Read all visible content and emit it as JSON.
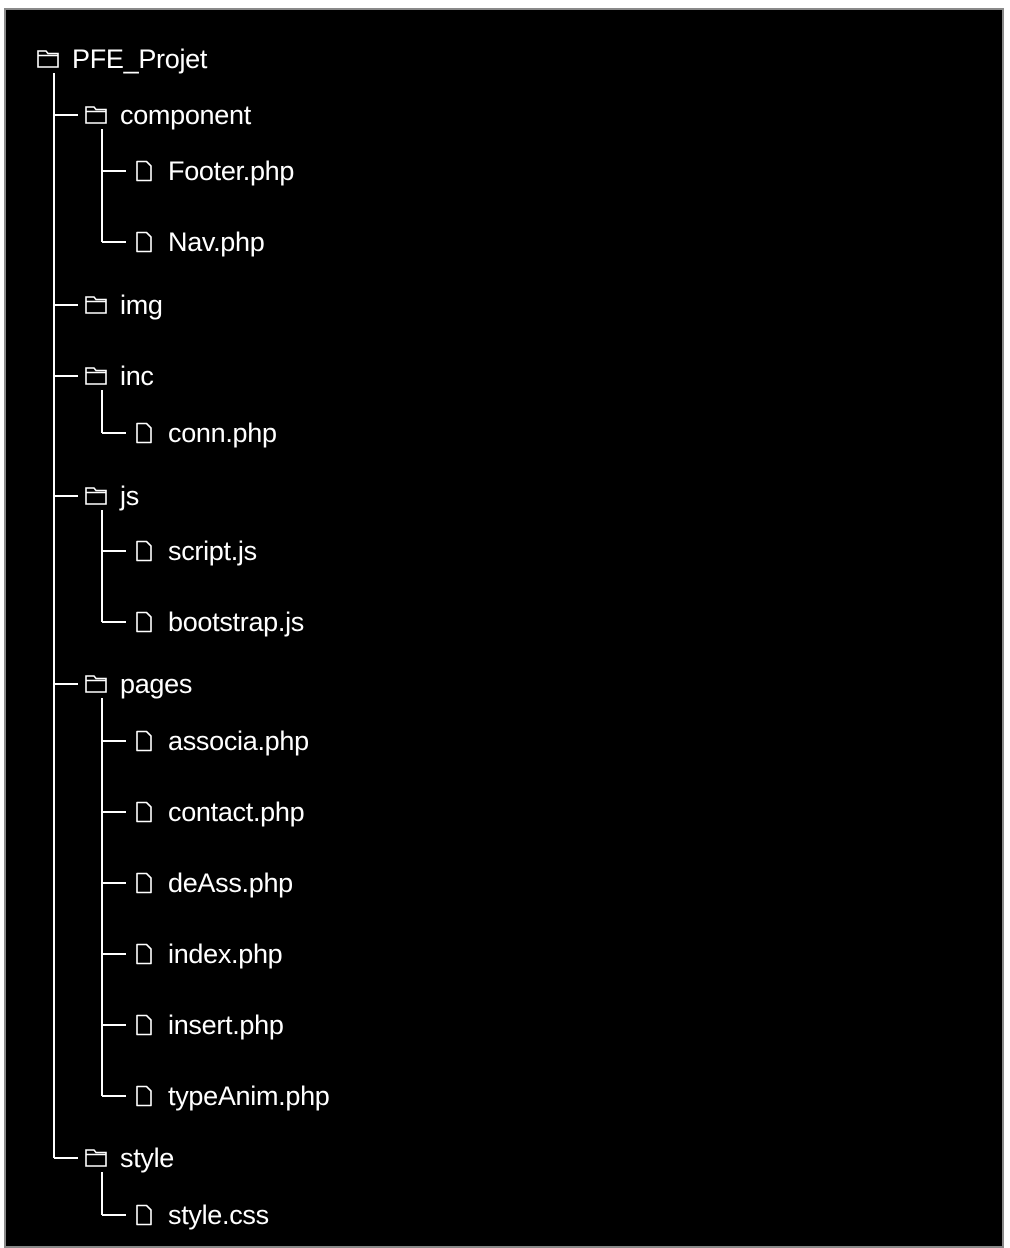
{
  "colors": {
    "background": "#000000",
    "text": "#ffffff",
    "border": "#8a8a8a"
  },
  "tree": {
    "label": "PFE_Projet",
    "icon": "folder-icon",
    "children": [
      {
        "label": "component",
        "icon": "folder-icon",
        "children": [
          {
            "label": "Footer.php",
            "icon": "file-icon"
          },
          {
            "label": "Nav.php",
            "icon": "file-icon"
          }
        ]
      },
      {
        "label": "img",
        "icon": "folder-icon"
      },
      {
        "label": "inc",
        "icon": "folder-icon",
        "children": [
          {
            "label": "conn.php",
            "icon": "file-icon"
          }
        ]
      },
      {
        "label": "js",
        "icon": "folder-icon",
        "children": [
          {
            "label": "script.js",
            "icon": "file-icon"
          },
          {
            "label": "bootstrap.js",
            "icon": "file-icon"
          }
        ]
      },
      {
        "label": "pages",
        "icon": "folder-icon",
        "children": [
          {
            "label": "associa.php",
            "icon": "file-icon"
          },
          {
            "label": "contact.php",
            "icon": "file-icon"
          },
          {
            "label": "deAss.php",
            "icon": "file-icon"
          },
          {
            "label": "index.php",
            "icon": "file-icon"
          },
          {
            "label": "insert.php",
            "icon": "file-icon"
          },
          {
            "label": "typeAnim.php",
            "icon": "file-icon"
          }
        ]
      },
      {
        "label": "style",
        "icon": "folder-icon",
        "children": [
          {
            "label": "style.css",
            "icon": "file-icon"
          }
        ]
      }
    ]
  }
}
